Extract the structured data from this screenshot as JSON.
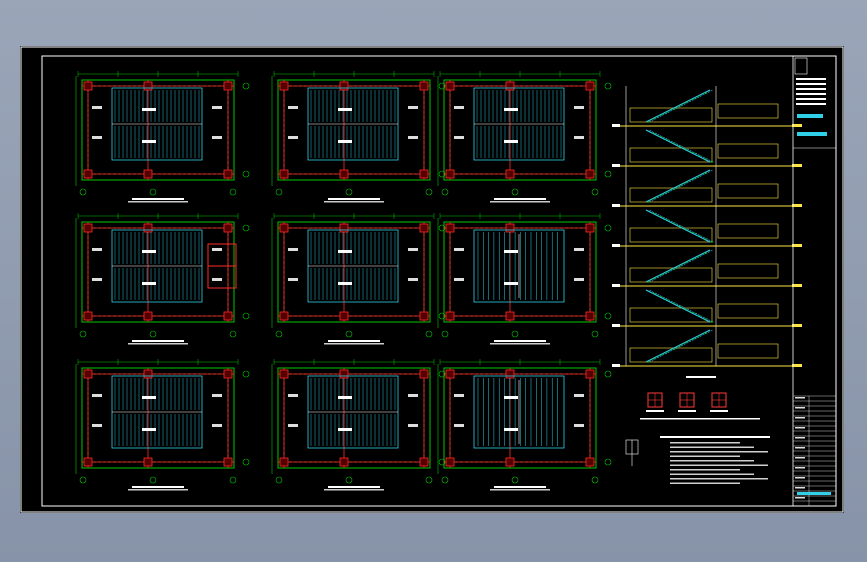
{
  "sheet": {
    "background": "#000000",
    "frame_color": "#ffffff",
    "colors": {
      "grid": "#00c800",
      "column": "#ff2a2a",
      "slab": "#2fd0e8",
      "dim": "#ffffff",
      "section": "#ffe640",
      "accent": "#ff40ff"
    }
  },
  "plans": [
    {
      "id": "plan-1",
      "style": "hatch-right"
    },
    {
      "id": "plan-2",
      "style": "hatch-right"
    },
    {
      "id": "plan-3",
      "style": "hatch-right"
    },
    {
      "id": "plan-4",
      "style": "hatch-red"
    },
    {
      "id": "plan-5",
      "style": "hatch-right"
    },
    {
      "id": "plan-6",
      "style": "hatch-down"
    },
    {
      "id": "plan-7",
      "style": "hatch-right"
    },
    {
      "id": "plan-8",
      "style": "hatch-right"
    },
    {
      "id": "plan-9",
      "style": "hatch-down"
    }
  ],
  "section": {
    "floors": 7
  },
  "details": {
    "count": 3
  },
  "title_block": {
    "rows": 22
  }
}
